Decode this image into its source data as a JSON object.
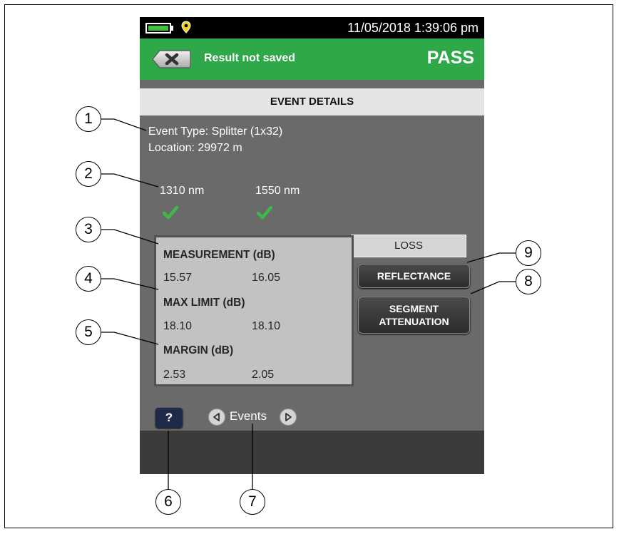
{
  "status_bar": {
    "datetime": "11/05/2018 1:39:06 pm",
    "icons": [
      "battery-icon",
      "gps-pin-icon"
    ]
  },
  "result_bar": {
    "close_icon": "close-icon",
    "status_text": "Result not saved",
    "verdict": "PASS"
  },
  "screen_title": "EVENT DETAILS",
  "event": {
    "type_text": "Event Type: Splitter (1x32)",
    "location_text": "Location: 29972 m"
  },
  "wavelengths": [
    {
      "label": "1310 nm",
      "status_icon": "pass-check-icon"
    },
    {
      "label": "1550 nm",
      "status_icon": "pass-check-icon"
    }
  ],
  "loss_panel": {
    "tab_label": "LOSS",
    "measurement": {
      "heading": "MEASUREMENT (dB)",
      "values": [
        "15.57",
        "16.05"
      ]
    },
    "max_limit": {
      "heading": "MAX LIMIT (dB)",
      "values": [
        "18.10",
        "18.10"
      ]
    },
    "margin": {
      "heading": "MARGIN (dB)",
      "values": [
        "2.53",
        "2.05"
      ]
    }
  },
  "side_buttons": {
    "reflectance": "REFLECTANCE",
    "segment_attenuation_line1": "SEGMENT",
    "segment_attenuation_line2": "ATTENUATION"
  },
  "nav": {
    "help_label": "?",
    "events_label": "Events"
  },
  "callouts": [
    "1",
    "2",
    "3",
    "4",
    "5",
    "6",
    "7",
    "8",
    "9"
  ],
  "colors": {
    "pass_green": "#2fa84a",
    "screen_bg": "#6a6a6a",
    "panel_bg": "#c4c1c4",
    "check_green": "#3fb84a"
  }
}
